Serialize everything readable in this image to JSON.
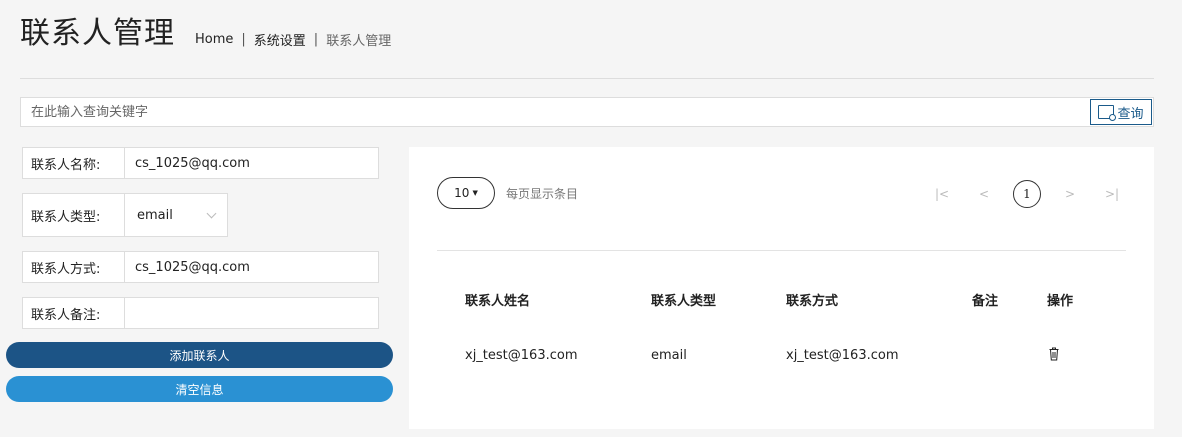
{
  "header": {
    "title": "联系人管理",
    "breadcrumb": [
      "Home",
      "系统设置",
      "联系人管理"
    ],
    "breadcrumb_sep": "|"
  },
  "search": {
    "placeholder": "在此输入查询关键字",
    "value": "",
    "button_label": "查询",
    "button_icon": "search-folder-icon"
  },
  "form": {
    "name_label": "联系人名称:",
    "name_value": "cs_1025@qq.com",
    "type_label": "联系人类型:",
    "type_value": "email",
    "contact_label": "联系人方式:",
    "contact_value": "cs_1025@qq.com",
    "note_label": "联系人备注:",
    "note_value": ""
  },
  "buttons": {
    "add": "添加联系人",
    "clear": "清空信息",
    "add_color": "#1c5486",
    "clear_color": "#2a91d3"
  },
  "table": {
    "page_size": "10",
    "page_size_label": "每页显示条目",
    "pager": {
      "first": "|<",
      "prev": "<",
      "current": "1",
      "next": ">",
      "last": ">|"
    },
    "columns": [
      "联系人姓名",
      "联系人类型",
      "联系方式",
      "备注",
      "操作"
    ],
    "rows": [
      {
        "name": "xj_test@163.com",
        "type": "email",
        "contact": "xj_test@163.com",
        "note": "",
        "action_icon": "trash-icon"
      }
    ]
  }
}
